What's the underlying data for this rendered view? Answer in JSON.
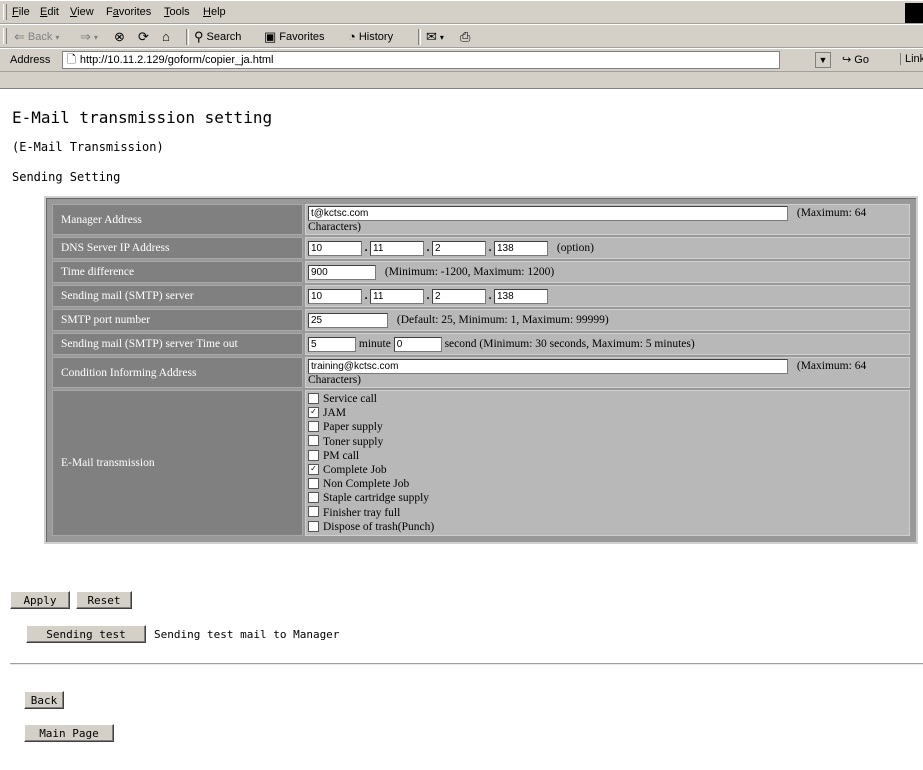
{
  "browser": {
    "menu": [
      {
        "pre": "",
        "u": "F",
        "post": "ile"
      },
      {
        "pre": "",
        "u": "E",
        "post": "dit"
      },
      {
        "pre": "",
        "u": "V",
        "post": "iew"
      },
      {
        "pre": "F",
        "u": "a",
        "post": "vorites"
      },
      {
        "pre": "",
        "u": "T",
        "post": "ools"
      },
      {
        "pre": "",
        "u": "H",
        "post": "elp"
      }
    ],
    "toolbar": {
      "back_label": "Back",
      "search_label": "Search",
      "favorites_label": "Favorites",
      "history_label": "History"
    },
    "address_label": "Address",
    "address_url": "http://10.11.2.129/goform/copier_ja.html",
    "go_label": "Go",
    "links_label": "Link"
  },
  "page": {
    "title": "E-Mail transmission setting",
    "subtitle": "(E-Mail Transmission)",
    "section": "Sending Setting"
  },
  "form": {
    "manager_address": {
      "label": "Manager Address",
      "value": "t@kctsc.com",
      "note": "(Maximum: 64",
      "note2": "Characters)"
    },
    "dns": {
      "label": "DNS Server IP Address",
      "octets": [
        "10",
        "11",
        "2",
        "138"
      ],
      "note": "(option)"
    },
    "time_diff": {
      "label": "Time difference",
      "value": "900",
      "note": "(Minimum: -1200, Maximum: 1200)"
    },
    "smtp_server": {
      "label": "Sending mail (SMTP) server",
      "octets": [
        "10",
        "11",
        "2",
        "138"
      ]
    },
    "smtp_port": {
      "label": "SMTP port number",
      "value": "25",
      "note": "(Default: 25, Minimum: 1, Maximum: 99999)"
    },
    "smtp_timeout": {
      "label": "Sending mail (SMTP) server Time out",
      "minute": "5",
      "minute_label": "minute",
      "second": "0",
      "second_note": "second (Minimum: 30 seconds, Maximum: 5 minutes)"
    },
    "condition_address": {
      "label": "Condition Informing Address",
      "value": "training@kctsc.com",
      "note": "(Maximum: 64",
      "note2": "Characters)"
    },
    "email_transmission": {
      "label": "E-Mail transmission",
      "options": [
        {
          "label": "Service call",
          "checked": false
        },
        {
          "label": "JAM",
          "checked": true
        },
        {
          "label": "Paper supply",
          "checked": false
        },
        {
          "label": "Toner supply",
          "checked": false
        },
        {
          "label": "PM call",
          "checked": false
        },
        {
          "label": "Complete Job",
          "checked": true
        },
        {
          "label": "Non Complete Job",
          "checked": false
        },
        {
          "label": "Staple cartridge supply",
          "checked": false
        },
        {
          "label": "Finisher tray full",
          "checked": false
        },
        {
          "label": "Dispose of trash(Punch)",
          "checked": false
        }
      ]
    }
  },
  "buttons": {
    "apply": "Apply",
    "reset": "Reset",
    "sending_test": "Sending test",
    "sending_test_hint": "Sending test mail to Manager",
    "back": "Back",
    "main_page": "Main Page"
  }
}
